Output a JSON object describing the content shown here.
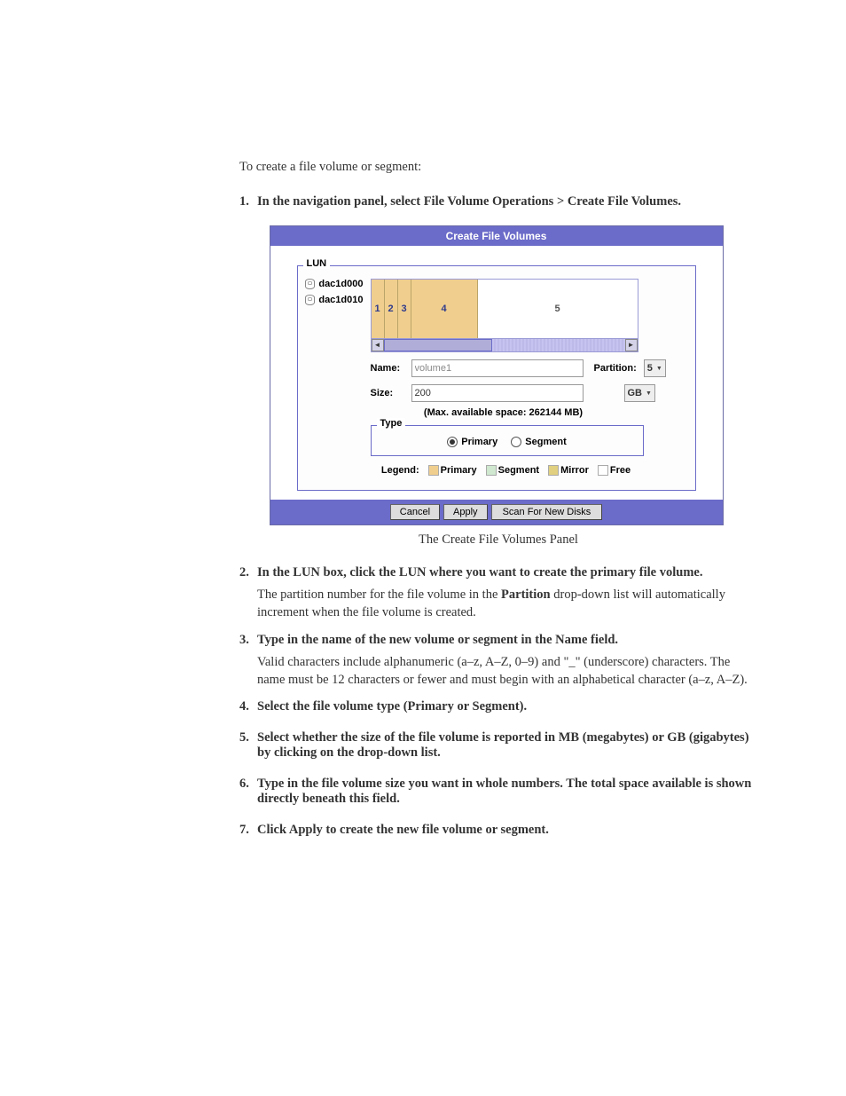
{
  "intro": "To create a file volume or segment:",
  "steps": {
    "1": {
      "num": "1.",
      "title": "In the navigation panel, select File Volume Operations > Create File Volumes."
    },
    "2": {
      "num": "2.",
      "title": "In the LUN box, click the LUN where you want to create the primary file volume.",
      "desc_before": "The partition number for the file volume in the ",
      "desc_bold": "Partition",
      "desc_after": " drop-down list will automatically increment when the file volume is created."
    },
    "3": {
      "num": "3.",
      "title": "Type in the name of the new volume or segment in the Name field.",
      "desc": "Valid characters include alphanumeric (a–z, A–Z, 0–9) and \"_\" (underscore) characters. The name must be 12 characters or fewer and must begin with an alphabetical character (a–z, A–Z)."
    },
    "4": {
      "num": "4.",
      "title": "Select the file volume type (Primary or Segment)."
    },
    "5": {
      "num": "5.",
      "title": "Select whether the size of the file volume is reported in MB (megabytes) or GB (gigabytes) by clicking on the drop-down list."
    },
    "6": {
      "num": "6.",
      "title": "Type in the file volume size you want in whole numbers. The total space available is shown directly beneath this field."
    },
    "7": {
      "num": "7.",
      "title": "Click Apply to create the new file volume or segment."
    }
  },
  "caption": "The Create File Volumes Panel",
  "panel": {
    "title": "Create File Volumes",
    "lun_legend": "LUN",
    "luns": {
      "a": "dac1d000",
      "b": "dac1d010"
    },
    "parts": {
      "p1": "1",
      "p2": "2",
      "p3": "3",
      "p4": "4",
      "p5": "5"
    },
    "name_label": "Name:",
    "name_value": "volume1",
    "partition_label": "Partition:",
    "partition_value": "5",
    "size_label": "Size:",
    "size_value": "200",
    "unit_value": "GB",
    "max_line": "(Max. available space: 262144 MB)",
    "type_legend": "Type",
    "type_primary": "Primary",
    "type_segment": "Segment",
    "legend_label": "Legend:",
    "legend_primary": "Primary",
    "legend_segment": "Segment",
    "legend_mirror": "Mirror",
    "legend_free": "Free",
    "btn_cancel": "Cancel",
    "btn_apply": "Apply",
    "btn_scan": "Scan For New Disks"
  }
}
